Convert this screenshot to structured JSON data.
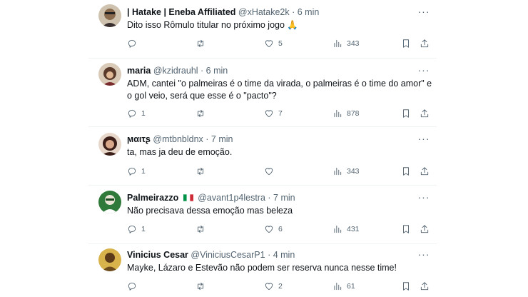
{
  "tweets": [
    {
      "name": "| Hatake | Eneba Affiliated",
      "handle": "@xHatake2k",
      "time": "· 6 min",
      "lines": [
        "Dito isso Rômulo titular no próximo jogo 🙏"
      ],
      "stats": {
        "replies": "",
        "retweets": "",
        "likes": "5",
        "views": "343"
      },
      "avatar_color": "#8a6b4d"
    },
    {
      "name": "maria",
      "handle": "@kzidrauhl",
      "time": "· 6 min",
      "lines": [
        "ADM, cantei \"o palmeiras é o time da virada, o palmeiras é o time do amor\" e",
        "o gol veio, será que esse é o \"pacto\"?"
      ],
      "stats": {
        "replies": "1",
        "retweets": "",
        "likes": "7",
        "views": "878"
      },
      "avatar_color": "#5a3b2b"
    },
    {
      "name": "ϻαιτʂ",
      "handle": "@mtbnbldnx",
      "time": "· 7 min",
      "lines": [
        "ta, mas ja deu de emoção."
      ],
      "stats": {
        "replies": "1",
        "retweets": "",
        "likes": "",
        "views": "343"
      },
      "avatar_color": "#4a2a22"
    },
    {
      "name": "Palmeirazzo",
      "flag": "italy-flag",
      "handle": "@avant1p4lestra",
      "time": "· 7 min",
      "lines": [
        "Não precisava dessa emoção mas beleza"
      ],
      "stats": {
        "replies": "1",
        "retweets": "",
        "likes": "6",
        "views": "431"
      },
      "avatar_color": "#2f7a3a"
    },
    {
      "name": "Vinicius Cesar",
      "handle": "@ViniciusCesarP1",
      "time": "· 4 min",
      "lines": [
        "Mayke, Lázaro e Estevão não podem ser reserva nunca nesse time!"
      ],
      "stats": {
        "replies": "",
        "retweets": "",
        "likes": "2",
        "views": "61"
      },
      "avatar_color": "#6b4a1e"
    }
  ]
}
